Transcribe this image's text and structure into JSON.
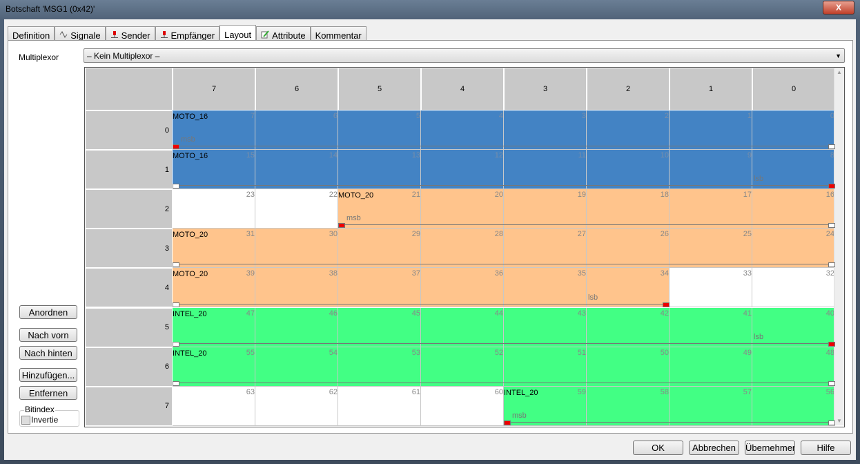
{
  "window": {
    "title": "Botschaft 'MSG1 (0x42)'",
    "close_label": "X"
  },
  "tabs": [
    {
      "label": "Definition",
      "icon": ""
    },
    {
      "label": "Signale",
      "icon": "signal-icon"
    },
    {
      "label": "Sender",
      "icon": "node-icon"
    },
    {
      "label": "Empfänger",
      "icon": "node-icon"
    },
    {
      "label": "Layout",
      "icon": "",
      "active": true
    },
    {
      "label": "Attribute",
      "icon": "edit-icon"
    },
    {
      "label": "Kommentar",
      "icon": ""
    }
  ],
  "multiplexor": {
    "label": "Multiplexor",
    "value": "– Kein Multiplexor –"
  },
  "side_buttons": [
    "Anordnen",
    "Nach vorn",
    "Nach hinten",
    "Hinzufügen...",
    "Entfernen"
  ],
  "bitindex": {
    "legend": "Bitindex",
    "checkbox_label": "Invertie",
    "checked": false
  },
  "dialog_buttons": [
    "OK",
    "Abbrechen",
    "Übernehmen",
    "Hilfe"
  ],
  "layout": {
    "column_headers": [
      "7",
      "6",
      "5",
      "4",
      "3",
      "2",
      "1",
      "0"
    ],
    "row_headers": [
      "0",
      "1",
      "2",
      "3",
      "4",
      "5",
      "6",
      "7"
    ],
    "signals": {
      "MOTO_16": {
        "color": "#4383c4",
        "bitno_color": "#7a8ea8"
      },
      "MOTO_20": {
        "color": "#ffc48c",
        "bitno_color": "#888888"
      },
      "INTEL_20": {
        "color": "#42ff84",
        "bitno_color": "#888888"
      }
    },
    "rows": [
      {
        "bits": [
          7,
          6,
          5,
          4,
          3,
          2,
          1,
          0
        ],
        "cells": [
          "MOTO_16",
          "MOTO_16",
          "MOTO_16",
          "MOTO_16",
          "MOTO_16",
          "MOTO_16",
          "MOTO_16",
          "MOTO_16"
        ],
        "label": {
          "text": "MOTO_16",
          "col": 0
        },
        "markers": [
          {
            "type": "msb",
            "col": 0,
            "side": "left",
            "text": "msb"
          }
        ],
        "span": [
          0,
          7
        ]
      },
      {
        "bits": [
          15,
          14,
          13,
          12,
          11,
          10,
          9,
          8
        ],
        "cells": [
          "MOTO_16",
          "MOTO_16",
          "MOTO_16",
          "MOTO_16",
          "MOTO_16",
          "MOTO_16",
          "MOTO_16",
          "MOTO_16"
        ],
        "label": {
          "text": "MOTO_16",
          "col": 0
        },
        "markers": [
          {
            "type": "lsb",
            "col": 7,
            "side": "right",
            "text": "lsb"
          }
        ],
        "span": [
          0,
          7
        ]
      },
      {
        "bits": [
          23,
          22,
          21,
          20,
          19,
          18,
          17,
          16
        ],
        "cells": [
          "",
          "",
          "MOTO_20",
          "MOTO_20",
          "MOTO_20",
          "MOTO_20",
          "MOTO_20",
          "MOTO_20"
        ],
        "label": {
          "text": "MOTO_20",
          "col": 2
        },
        "markers": [
          {
            "type": "msb",
            "col": 2,
            "side": "left",
            "text": "msb"
          }
        ],
        "span": [
          2,
          7
        ]
      },
      {
        "bits": [
          31,
          30,
          29,
          28,
          27,
          26,
          25,
          24
        ],
        "cells": [
          "MOTO_20",
          "MOTO_20",
          "MOTO_20",
          "MOTO_20",
          "MOTO_20",
          "MOTO_20",
          "MOTO_20",
          "MOTO_20"
        ],
        "label": {
          "text": "MOTO_20",
          "col": 0
        },
        "markers": [],
        "span": [
          0,
          7
        ]
      },
      {
        "bits": [
          39,
          38,
          37,
          36,
          35,
          34,
          33,
          32
        ],
        "cells": [
          "MOTO_20",
          "MOTO_20",
          "MOTO_20",
          "MOTO_20",
          "MOTO_20",
          "MOTO_20",
          "",
          ""
        ],
        "label": {
          "text": "MOTO_20",
          "col": 0
        },
        "markers": [
          {
            "type": "lsb",
            "col": 5,
            "side": "right",
            "text": "lsb"
          }
        ],
        "span": [
          0,
          5
        ]
      },
      {
        "bits": [
          47,
          46,
          45,
          44,
          43,
          42,
          41,
          40
        ],
        "cells": [
          "INTEL_20",
          "INTEL_20",
          "INTEL_20",
          "INTEL_20",
          "INTEL_20",
          "INTEL_20",
          "INTEL_20",
          "INTEL_20"
        ],
        "label": {
          "text": "INTEL_20",
          "col": 0
        },
        "markers": [
          {
            "type": "lsb",
            "col": 7,
            "side": "right",
            "text": "lsb"
          }
        ],
        "span": [
          0,
          7
        ]
      },
      {
        "bits": [
          55,
          54,
          53,
          52,
          51,
          50,
          49,
          48
        ],
        "cells": [
          "INTEL_20",
          "INTEL_20",
          "INTEL_20",
          "INTEL_20",
          "INTEL_20",
          "INTEL_20",
          "INTEL_20",
          "INTEL_20"
        ],
        "label": {
          "text": "INTEL_20",
          "col": 0
        },
        "markers": [],
        "span": [
          0,
          7
        ]
      },
      {
        "bits": [
          63,
          62,
          61,
          60,
          59,
          58,
          57,
          56
        ],
        "cells": [
          "",
          "",
          "",
          "",
          "INTEL_20",
          "INTEL_20",
          "INTEL_20",
          "INTEL_20"
        ],
        "label": {
          "text": "INTEL_20",
          "col": 4
        },
        "markers": [
          {
            "type": "msb",
            "col": 4,
            "side": "left",
            "text": "msb"
          }
        ],
        "span": [
          4,
          7
        ]
      }
    ]
  }
}
